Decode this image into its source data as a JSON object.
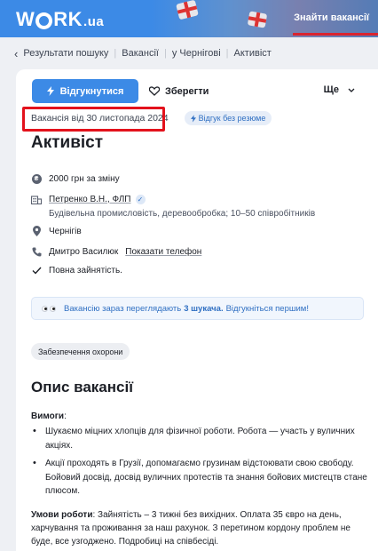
{
  "header": {
    "logo_main": "W",
    "logo_rk": "RK",
    "logo_ua": ".ua",
    "find_jobs_link": "Знайти вакансії"
  },
  "breadcrumb": {
    "items": [
      "Результати пошуку",
      "Вакансії",
      "у Чернігові",
      "Активіст"
    ]
  },
  "actions": {
    "apply_label": "Відгукнутися",
    "save_label": "Зберегти",
    "more_label": "Ще"
  },
  "vacancy": {
    "date_text": "Вакансія від 30 листопада 2024",
    "badge_text": "Відгук без резюме",
    "title": "Активіст",
    "salary": "2000 грн за зміну",
    "company": "Петренко В.Н., ФЛП",
    "company_details": "Будівельна промисловість, деревообробка; 10–50 співробітників",
    "city": "Чернігів",
    "contact_name": "Дмитро Василюк",
    "show_phone": "Показати телефон",
    "employment": "Повна зайнятість."
  },
  "notice": {
    "text_before": "Вакансію зараз переглядають",
    "viewers": "3 шукача.",
    "text_after": "Відгукніться першим!"
  },
  "tag": "Забезпечення охорони",
  "description": {
    "section_title": "Опис вакансії",
    "requirements_label": "Вимоги",
    "requirements_colon": ":",
    "bullets": [
      "Шукаємо міцних хлопців для фізичної роботи. Робота — участь у вуличних акціях.",
      "Акції проходять в Грузії, допомагаємо грузинам відстоювати свою свободу. Бойовий досвід, досвід вуличних протестів та знання бойових мистецтв стане плюсом."
    ],
    "conditions_label": "Умови роботи",
    "conditions_text": ": Зайнятість – 3 тижні без вихідних. Оплата 35 євро на день, харчування та проживання за наш рахунок. З перетином кордону проблем не буде, все узгоджено. Подробиці на співбесіді."
  },
  "colors": {
    "accent": "#3c8ae6",
    "highlight": "#e3121c",
    "header_underline": "#d9242f"
  }
}
